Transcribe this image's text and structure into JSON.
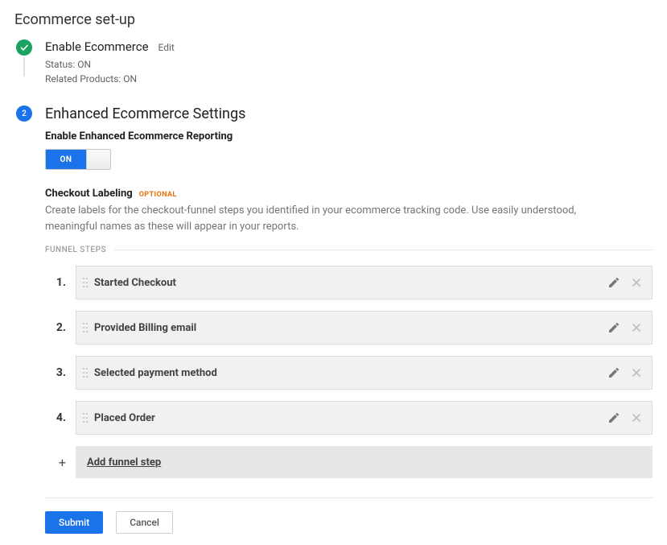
{
  "page_title": "Ecommerce set-up",
  "step1": {
    "title": "Enable Ecommerce",
    "edit_label": "Edit",
    "status_label": "Status: ON",
    "related_label": "Related Products: ON"
  },
  "step2": {
    "number": "2",
    "title": "Enhanced Ecommerce Settings",
    "enable_reporting_label": "Enable Enhanced Ecommerce Reporting",
    "toggle_value": "ON",
    "checkout_labeling_title": "Checkout Labeling",
    "optional_tag": "OPTIONAL",
    "checkout_help": "Create labels for the checkout-funnel steps you identified in your ecommerce tracking code. Use easily understood, meaningful names as these will appear in your reports.",
    "funnel_section_label": "FUNNEL STEPS",
    "funnel_steps": [
      {
        "num": "1.",
        "label": "Started Checkout"
      },
      {
        "num": "2.",
        "label": "Provided Billing email"
      },
      {
        "num": "3.",
        "label": "Selected payment method"
      },
      {
        "num": "4.",
        "label": "Placed Order"
      }
    ],
    "add_plus": "+",
    "add_label": "Add funnel step"
  },
  "actions": {
    "submit": "Submit",
    "cancel": "Cancel"
  }
}
